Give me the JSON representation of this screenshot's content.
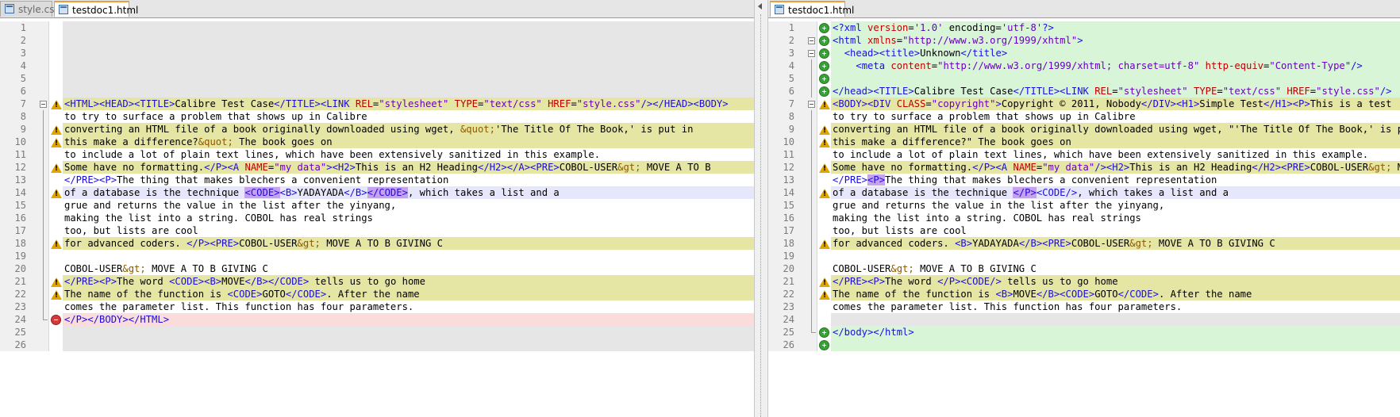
{
  "left": {
    "tabs": [
      {
        "label": "style.css",
        "active": false
      },
      {
        "label": "testdoc1.html",
        "active": true
      }
    ],
    "lines": [
      {
        "n": "1",
        "bg": "empty",
        "mark": "",
        "fold": "",
        "html": ""
      },
      {
        "n": "2",
        "bg": "empty",
        "mark": "",
        "fold": "",
        "html": ""
      },
      {
        "n": "3",
        "bg": "empty",
        "mark": "",
        "fold": "",
        "html": ""
      },
      {
        "n": "4",
        "bg": "empty",
        "mark": "",
        "fold": "",
        "html": ""
      },
      {
        "n": "5",
        "bg": "empty",
        "mark": "",
        "fold": "",
        "html": ""
      },
      {
        "n": "6",
        "bg": "empty",
        "mark": "",
        "fold": "",
        "html": ""
      },
      {
        "n": "7",
        "bg": "changed",
        "mark": "warn",
        "fold": "box",
        "html": "<span class=\"t\">&lt;HTML&gt;&lt;HEAD&gt;&lt;TITLE&gt;</span>Calibre Test Case<span class=\"t\">&lt;/TITLE&gt;&lt;LINK</span> <span class=\"a\">REL</span>=<span class=\"v\">\"stylesheet\"</span> <span class=\"a\">TYPE</span>=<span class=\"v\">\"text/css\"</span> <span class=\"a\">HREF</span>=<span class=\"v\">\"style.css\"</span><span class=\"t\">/&gt;&lt;/HEAD&gt;&lt;BODY&gt;</span>"
      },
      {
        "n": "8",
        "bg": "plain",
        "mark": "",
        "fold": "line",
        "html": "to try to surface a problem that shows up in Calibre"
      },
      {
        "n": "9",
        "bg": "changed",
        "mark": "warn",
        "fold": "line",
        "html": "converting an HTML file of a book originally downloaded using wget, <span class=\"e\">&amp;quot;</span>'The Title Of The Book,' is put in"
      },
      {
        "n": "10",
        "bg": "changed",
        "mark": "warn",
        "fold": "line",
        "html": "this make a difference?<span class=\"e\">&amp;quot;</span> The book goes on"
      },
      {
        "n": "11",
        "bg": "plain",
        "mark": "",
        "fold": "line",
        "html": "to include a lot of plain text lines, which have been extensively sanitized in this example."
      },
      {
        "n": "12",
        "bg": "changed",
        "mark": "warn",
        "fold": "line",
        "html": "Some have no formatting.<span class=\"t\">&lt;/P&gt;&lt;A</span> <span class=\"a\">NAME</span>=<span class=\"v\">\"my data\"</span><span class=\"t\">&gt;&lt;H2&gt;</span>This is an H2 Heading<span class=\"t\">&lt;/H2&gt;&lt;/A&gt;&lt;PRE&gt;</span>COBOL-USER<span class=\"e\">&amp;gt;</span> MOVE A TO B"
      },
      {
        "n": "13",
        "bg": "plain",
        "mark": "",
        "fold": "line",
        "html": "<span class=\"t\">&lt;/PRE&gt;&lt;P&gt;</span>The thing that makes blechers a convenient representation"
      },
      {
        "n": "14",
        "bg": "hl",
        "mark": "warn",
        "fold": "line",
        "html": "of a database is the technique <span class=\"hi\">&lt;CODE&gt;</span><span class=\"t\">&lt;B&gt;</span>YADAYADA<span class=\"t\">&lt;/B&gt;</span><span class=\"hi\">&lt;/CODE&gt;</span>, which takes a list and a"
      },
      {
        "n": "15",
        "bg": "plain",
        "mark": "",
        "fold": "line",
        "html": "grue and returns the value in the list after the yinyang,"
      },
      {
        "n": "16",
        "bg": "plain",
        "mark": "",
        "fold": "line",
        "html": "making the list into a string. COBOL has real strings"
      },
      {
        "n": "17",
        "bg": "plain",
        "mark": "",
        "fold": "line",
        "html": "too, but lists are cool"
      },
      {
        "n": "18",
        "bg": "changed",
        "mark": "warn",
        "fold": "line",
        "html": "for advanced coders. <span class=\"t\">&lt;/P&gt;&lt;PRE&gt;</span>COBOL-USER<span class=\"e\">&amp;gt;</span> MOVE A TO B GIVING C"
      },
      {
        "n": "19",
        "bg": "plain",
        "mark": "",
        "fold": "line",
        "html": ""
      },
      {
        "n": "20",
        "bg": "plain",
        "mark": "",
        "fold": "line",
        "html": "COBOL-USER<span class=\"e\">&amp;gt;</span> MOVE A TO B GIVING C"
      },
      {
        "n": "21",
        "bg": "changed",
        "mark": "warn",
        "fold": "line",
        "html": "<span class=\"t\">&lt;/PRE&gt;&lt;P&gt;</span>The word <span class=\"t\">&lt;CODE&gt;&lt;B&gt;</span>MOVE<span class=\"t\">&lt;/B&gt;&lt;/CODE&gt;</span> tells us to go home"
      },
      {
        "n": "22",
        "bg": "changed",
        "mark": "warn",
        "fold": "line",
        "html": "The name of the function is <span class=\"t\">&lt;CODE&gt;</span>GOTO<span class=\"t\">&lt;/CODE&gt;</span>. After the name"
      },
      {
        "n": "23",
        "bg": "plain",
        "mark": "",
        "fold": "line",
        "html": "comes the parameter list. This function has four parameters."
      },
      {
        "n": "24",
        "bg": "removed",
        "mark": "minus",
        "fold": "end",
        "html": "<span class=\"t\">&lt;/P&gt;&lt;/BODY&gt;&lt;/HTML&gt;</span>"
      },
      {
        "n": "25",
        "bg": "empty",
        "mark": "",
        "fold": "",
        "html": ""
      },
      {
        "n": "26",
        "bg": "empty",
        "mark": "",
        "fold": "",
        "html": ""
      }
    ]
  },
  "right": {
    "tabs": [
      {
        "label": "testdoc1.html",
        "active": true
      }
    ],
    "lines": [
      {
        "n": "1",
        "bg": "added",
        "mark": "plus",
        "fold": "",
        "html": "<span class=\"t\">&lt;?xml</span> <span class=\"a\">version</span>=<span class=\"v\">'1.0'</span> encoding=<span class=\"v\">'utf-8'</span><span class=\"t\">?&gt;</span>"
      },
      {
        "n": "2",
        "bg": "added",
        "mark": "plus",
        "fold": "box",
        "html": "<span class=\"t\">&lt;html</span> <span class=\"a\">xmlns</span>=<span class=\"v\">\"http://www.w3.org/1999/xhtml\"</span><span class=\"t\">&gt;</span>"
      },
      {
        "n": "3",
        "bg": "added",
        "mark": "plus",
        "fold": "box",
        "html": "  <span class=\"t\">&lt;head&gt;&lt;title&gt;</span>Unknown<span class=\"t\">&lt;/title&gt;</span>"
      },
      {
        "n": "4",
        "bg": "added",
        "mark": "plus",
        "fold": "line",
        "html": "    <span class=\"t\">&lt;meta</span> <span class=\"a\">content</span>=<span class=\"v\">\"http://www.w3.org/1999/xhtml; charset=utf-8\"</span> <span class=\"a\">http-equiv</span>=<span class=\"v\">\"Content-Type\"</span><span class=\"t\">/&gt;</span>"
      },
      {
        "n": "5",
        "bg": "added",
        "mark": "plus",
        "fold": "line",
        "html": ""
      },
      {
        "n": "6",
        "bg": "added",
        "mark": "plus",
        "fold": "line",
        "html": "<span class=\"t\">&lt;/head&gt;&lt;TITLE&gt;</span>Calibre Test Case<span class=\"t\">&lt;/TITLE&gt;&lt;LINK</span> <span class=\"a\">REL</span>=<span class=\"v\">\"stylesheet\"</span> <span class=\"a\">TYPE</span>=<span class=\"v\">\"text/css\"</span> <span class=\"a\">HREF</span>=<span class=\"v\">\"style.css\"</span><span class=\"t\">/&gt;</span>"
      },
      {
        "n": "7",
        "bg": "changed",
        "mark": "warn",
        "fold": "box",
        "html": "<span class=\"t\">&lt;BODY&gt;&lt;DIV</span> <span class=\"a\">CLASS</span>=<span class=\"v\">\"copyright\"</span><span class=\"t\">&gt;</span>Copyright © 2011, Nobody<span class=\"t\">&lt;/DIV&gt;&lt;H1&gt;</span>Simple Test<span class=\"t\">&lt;/H1&gt;&lt;P&gt;</span>This is a test"
      },
      {
        "n": "8",
        "bg": "plain",
        "mark": "",
        "fold": "line",
        "html": "to try to surface a problem that shows up in Calibre"
      },
      {
        "n": "9",
        "bg": "changed",
        "mark": "warn",
        "fold": "line",
        "html": "converting an HTML file of a book originally downloaded using wget, \"'The Title Of The Book,' is put in"
      },
      {
        "n": "10",
        "bg": "changed",
        "mark": "warn",
        "fold": "line",
        "html": "this make a difference?\" The book goes on"
      },
      {
        "n": "11",
        "bg": "plain",
        "mark": "",
        "fold": "line",
        "html": "to include a lot of plain text lines, which have been extensively sanitized in this example."
      },
      {
        "n": "12",
        "bg": "changed",
        "mark": "warn",
        "fold": "line",
        "html": "Some have no formatting.<span class=\"t\">&lt;/P&gt;&lt;A</span> <span class=\"a\">NAME</span>=<span class=\"v\">\"my data\"</span><span class=\"t\">/&gt;&lt;H2&gt;</span>This is an H2 Heading<span class=\"t\">&lt;/H2&gt;&lt;PRE&gt;</span>COBOL-USER<span class=\"e\">&amp;gt;</span> MOVE A TO B"
      },
      {
        "n": "13",
        "bg": "plain",
        "mark": "",
        "fold": "line",
        "html": "<span class=\"t\">&lt;/PRE&gt;</span><span class=\"hi\">&lt;P&gt;</span>The thing that makes blechers a convenient representation"
      },
      {
        "n": "14",
        "bg": "hl",
        "mark": "warn",
        "fold": "line",
        "html": "of a database is the technique <span class=\"hi\">&lt;/P&gt;</span><span class=\"t\">&lt;CODE/&gt;</span>, which takes a list and a"
      },
      {
        "n": "15",
        "bg": "plain",
        "mark": "",
        "fold": "line",
        "html": "grue and returns the value in the list after the yinyang,"
      },
      {
        "n": "16",
        "bg": "plain",
        "mark": "",
        "fold": "line",
        "html": "making the list into a string. COBOL has real strings"
      },
      {
        "n": "17",
        "bg": "plain",
        "mark": "",
        "fold": "line",
        "html": "too, but lists are cool"
      },
      {
        "n": "18",
        "bg": "changed",
        "mark": "warn",
        "fold": "line",
        "html": "for advanced coders. <span class=\"t\">&lt;B&gt;</span>YADAYADA<span class=\"t\">&lt;/B&gt;&lt;PRE&gt;</span>COBOL-USER<span class=\"e\">&amp;gt;</span> MOVE A TO B GIVING C"
      },
      {
        "n": "19",
        "bg": "plain",
        "mark": "",
        "fold": "line",
        "html": ""
      },
      {
        "n": "20",
        "bg": "plain",
        "mark": "",
        "fold": "line",
        "html": "COBOL-USER<span class=\"e\">&amp;gt;</span> MOVE A TO B GIVING C"
      },
      {
        "n": "21",
        "bg": "changed",
        "mark": "warn",
        "fold": "line",
        "html": "<span class=\"t\">&lt;/PRE&gt;&lt;P&gt;</span>The word <span class=\"t\">&lt;/P&gt;&lt;CODE/&gt;</span> tells us to go home"
      },
      {
        "n": "22",
        "bg": "changed",
        "mark": "warn",
        "fold": "line",
        "html": "The name of the function is <span class=\"t\">&lt;B&gt;</span>MOVE<span class=\"t\">&lt;/B&gt;&lt;CODE&gt;</span>GOTO<span class=\"t\">&lt;/CODE&gt;</span>. After the name"
      },
      {
        "n": "23",
        "bg": "plain",
        "mark": "",
        "fold": "line",
        "html": "comes the parameter list. This function has four parameters."
      },
      {
        "n": "24",
        "bg": "empty",
        "mark": "",
        "fold": "line",
        "html": ""
      },
      {
        "n": "25",
        "bg": "added",
        "mark": "plus",
        "fold": "end",
        "html": "<span class=\"t\">&lt;/body&gt;&lt;/html&gt;</span>"
      },
      {
        "n": "26",
        "bg": "added",
        "mark": "plus",
        "fold": "",
        "html": ""
      }
    ]
  }
}
